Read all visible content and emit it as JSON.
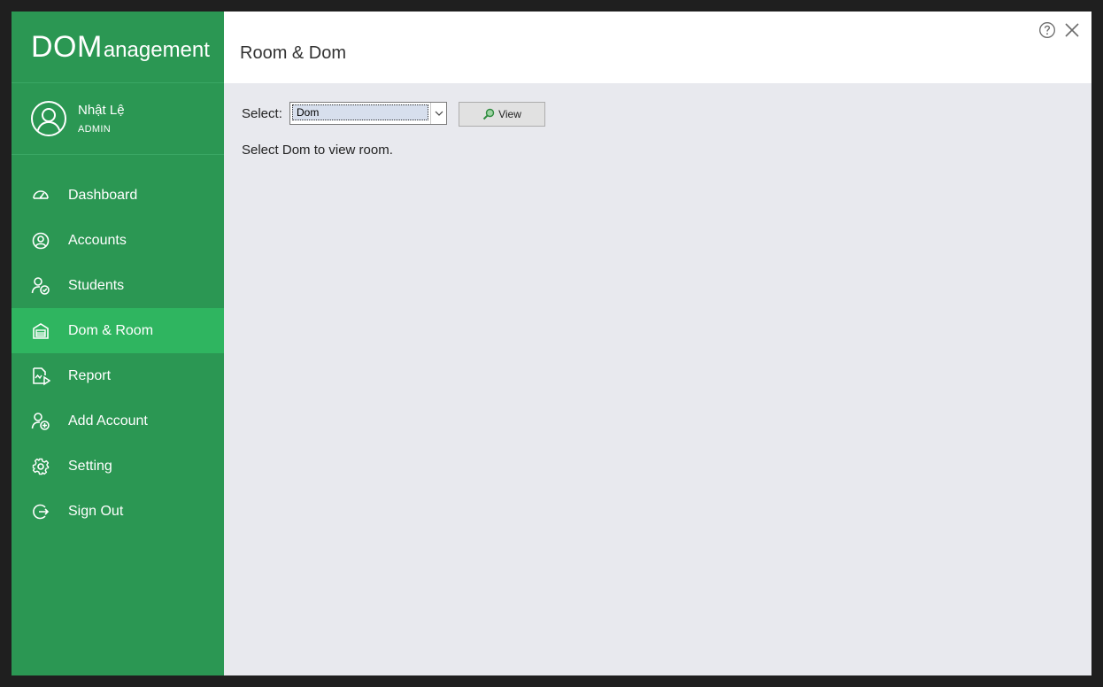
{
  "brand": {
    "big": "DOM",
    "small": "anagement"
  },
  "user": {
    "name": "Nhật Lệ",
    "role": "ADMIN"
  },
  "nav": [
    {
      "label": "Dashboard",
      "icon": "dashboard-icon"
    },
    {
      "label": "Accounts",
      "icon": "account-icon"
    },
    {
      "label": "Students",
      "icon": "student-icon"
    },
    {
      "label": "Dom & Room",
      "icon": "building-icon",
      "active": true
    },
    {
      "label": "Report",
      "icon": "report-icon"
    },
    {
      "label": "Add Account",
      "icon": "add-user-icon"
    },
    {
      "label": "Setting",
      "icon": "gear-icon"
    },
    {
      "label": "Sign Out",
      "icon": "sign-out-icon"
    }
  ],
  "header": {
    "title": "Room & Dom"
  },
  "content": {
    "select_label": "Select:",
    "select_value": "Dom",
    "view_label": "View",
    "hint": "Select Dom to view room."
  },
  "colors": {
    "sidebar": "#2b9753",
    "active": "#2fb560",
    "main_bg": "#e8e9ee"
  }
}
